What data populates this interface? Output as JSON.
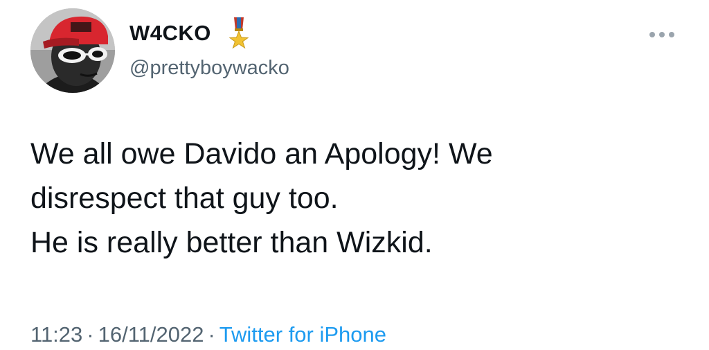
{
  "user": {
    "display_name": "W4CKO",
    "handle": "@prettyboywacko",
    "avatar_icon": "profile-photo",
    "badge_icon": "military-medal-icon"
  },
  "tweet": {
    "lines": [
      "We all owe Davido an Apology! We",
      "disrespect that guy too.",
      "He is really better than Wizkid."
    ],
    "time": "11:23",
    "date": "16/11/2022",
    "separator": "·",
    "source": "Twitter for iPhone"
  },
  "menu": {
    "more_icon": "more-options-icon"
  },
  "colors": {
    "text": "#0f1419",
    "secondary": "#536471",
    "link": "#1d9bf0",
    "more_dots": "#9aa4ad"
  }
}
